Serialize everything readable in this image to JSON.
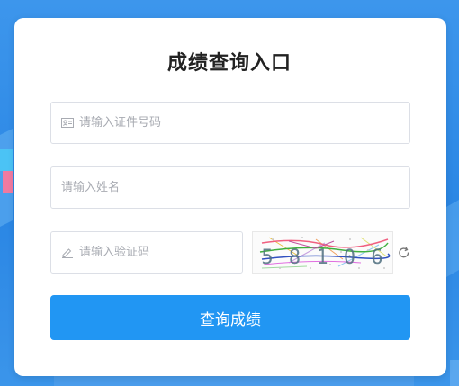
{
  "title": "成绩查询入口",
  "fields": {
    "id_number": {
      "placeholder": "请输入证件号码",
      "icon": "id-card-icon"
    },
    "name": {
      "placeholder": "请输入姓名"
    },
    "captcha": {
      "placeholder": "请输入验证码",
      "icon": "pencil-icon"
    }
  },
  "captcha_image": {
    "code": "5 8 1 0 6"
  },
  "refresh_icon": "refresh-icon",
  "submit_label": "查询成绩",
  "colors": {
    "accent": "#2196f3",
    "background": "#2a86e4"
  }
}
